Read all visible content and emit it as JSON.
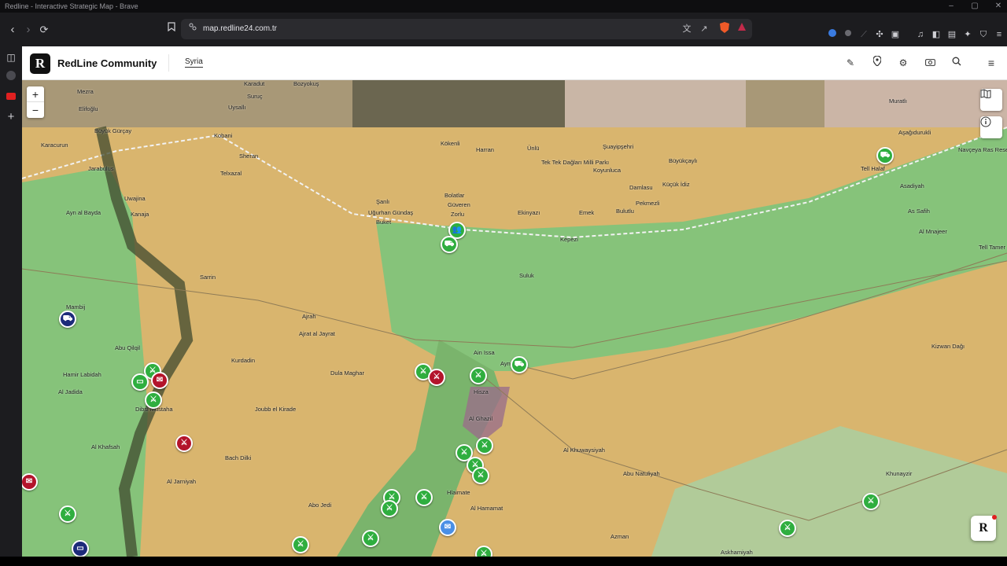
{
  "window": {
    "title": "Redline - Interactive Strategic Map - Brave"
  },
  "browser": {
    "url": "map.redline24.com.tr",
    "back_icon": "‹",
    "forward_icon": "›",
    "reload_icon": "⟳",
    "bookmark_icon": "🔖",
    "win_min": "–",
    "win_max": "▢",
    "win_close": "✕"
  },
  "app": {
    "logo_letter": "R",
    "brand": "RedLine Community",
    "tab_label": "Syria",
    "zoom_in": "+",
    "zoom_out": "−",
    "fab_letter": "R"
  },
  "places": [
    {
      "name": "Karadut"
    },
    {
      "name": "Bozyokuş"
    },
    {
      "name": "Mezra"
    },
    {
      "name": "Elifoğlu"
    },
    {
      "name": "Uysallı"
    },
    {
      "name": "Suruç"
    },
    {
      "name": "Büyük Gürçay"
    },
    {
      "name": "Karacurun"
    },
    {
      "name": "Kobani"
    },
    {
      "name": "Sheran"
    },
    {
      "name": "Telxazal"
    },
    {
      "name": "Jarabulus"
    },
    {
      "name": "Uwajina"
    },
    {
      "name": "Kanaja"
    },
    {
      "name": "Ayn al Bayda"
    },
    {
      "name": "Sarrin"
    },
    {
      "name": "Kökenli"
    },
    {
      "name": "Harran"
    },
    {
      "name": "Ünlü"
    },
    {
      "name": "Tek Tek Dağları Milli Parkı"
    },
    {
      "name": "Şuayipşehri"
    },
    {
      "name": "Koyunluca"
    },
    {
      "name": "Büyükçaylı"
    },
    {
      "name": "Damlasu"
    },
    {
      "name": "Küçük İdiz"
    },
    {
      "name": "Pekmezli"
    },
    {
      "name": "Bulutlu"
    },
    {
      "name": "Bolatlar"
    },
    {
      "name": "Güveren"
    },
    {
      "name": "Zorlu"
    },
    {
      "name": "Şanlı"
    },
    {
      "name": "Uğurhan Gündaş"
    },
    {
      "name": "Buket"
    },
    {
      "name": "Ekinyazı"
    },
    {
      "name": "Emek"
    },
    {
      "name": "Kepezi"
    },
    {
      "name": "Muratlı"
    },
    {
      "name": "Aşağıdurukli"
    },
    {
      "name": "Tell Halaf"
    },
    {
      "name": "Asadiyah"
    },
    {
      "name": "As Safih"
    },
    {
      "name": "Al Mnajeer"
    },
    {
      "name": "Navçeya Ras Resen"
    },
    {
      "name": "Tell Tamer"
    },
    {
      "name": "Suluk"
    },
    {
      "name": "Mambij"
    },
    {
      "name": "Abu Qilqil"
    },
    {
      "name": "Hamir Labidah"
    },
    {
      "name": "Al Jadida"
    },
    {
      "name": "Dibsi Mustaha"
    },
    {
      "name": "Al Khafsah"
    },
    {
      "name": "Al Jarniyah"
    },
    {
      "name": "Bach Dilki"
    },
    {
      "name": "Ajrat al Jayrat"
    },
    {
      "name": "Kurdadin"
    },
    {
      "name": "Dula Maghar"
    },
    {
      "name": "Joubb el Kirade"
    },
    {
      "name": "Ain Issa"
    },
    {
      "name": "Hisza"
    },
    {
      "name": "Al Ghazil"
    },
    {
      "name": "Al Khuwaysiyah"
    },
    {
      "name": "Abu Natuliyah"
    },
    {
      "name": "Khunayzir"
    },
    {
      "name": "Kizwan Dağı"
    },
    {
      "name": "Abo Jedi"
    },
    {
      "name": "Al Hamamat"
    },
    {
      "name": "Azman"
    },
    {
      "name": "Askhamiyah"
    },
    {
      "name": "Hlaimate"
    },
    {
      "name": "Ayn Isa"
    },
    {
      "name": "Ajrah"
    }
  ],
  "colors": {
    "terrain": "#b4a27a",
    "sdf_zone": "#86c37a",
    "govt_zone": "#d9b56e",
    "river": "#3f4a2f",
    "border": "#f2f2f2",
    "marker_green": "#2fae3f",
    "marker_red": "#b3142b",
    "marker_blue": "#1d2b7a"
  },
  "icons": {
    "tank": "▭",
    "gun": "⚔",
    "truck": "⛟",
    "radio": "✉",
    "people": "👥"
  }
}
